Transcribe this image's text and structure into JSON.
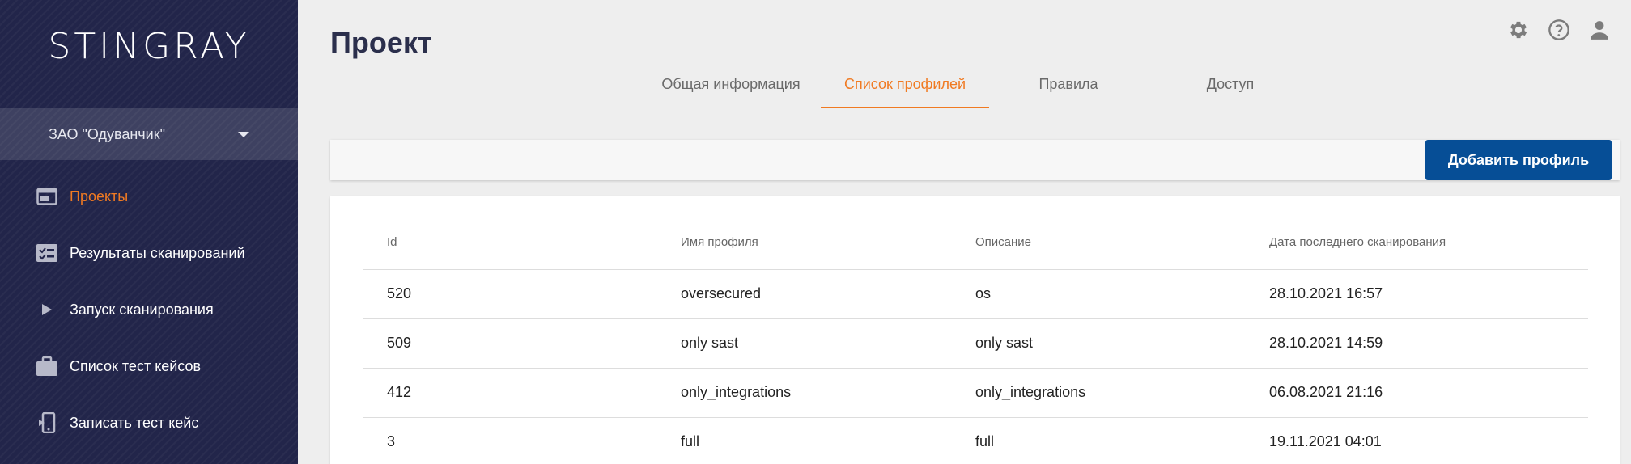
{
  "app": {
    "logo_text": "STINGRAY"
  },
  "sidebar": {
    "org_selector": {
      "label": "ЗАО \"Одуванчик\""
    },
    "items": [
      {
        "label": "Проекты",
        "icon": "projects-icon",
        "active": true
      },
      {
        "label": "Результаты сканирований",
        "icon": "scan-results-icon"
      },
      {
        "label": "Запуск сканирования",
        "icon": "play-icon"
      },
      {
        "label": "Список тест кейсов",
        "icon": "briefcase-icon"
      },
      {
        "label": "Записать тест кейс",
        "icon": "record-device-icon"
      }
    ]
  },
  "header": {
    "title": "Проект",
    "icons": [
      "gear-icon",
      "help-icon",
      "user-icon"
    ],
    "tabs": [
      {
        "label": "Общая информация"
      },
      {
        "label": "Список профилей",
        "active": true
      },
      {
        "label": "Правила"
      },
      {
        "label": "Доступ"
      }
    ]
  },
  "toolbar": {
    "add_profile_label": "Добавить профиль"
  },
  "table": {
    "columns": [
      "Id",
      "Имя профиля",
      "Описание",
      "Дата последнего сканирования"
    ],
    "rows": [
      [
        "520",
        "oversecured",
        "os",
        "28.10.2021 16:57"
      ],
      [
        "509",
        "only sast",
        "only sast",
        "28.10.2021 14:59"
      ],
      [
        "412",
        "only_integrations",
        "only_integrations",
        "06.08.2021 21:16"
      ],
      [
        "3",
        "full",
        "full",
        "19.11.2021 04:01"
      ]
    ]
  },
  "colors": {
    "accent": "#f07a22",
    "primary_button": "#064e96",
    "sidebar_bg": "#22254a"
  }
}
